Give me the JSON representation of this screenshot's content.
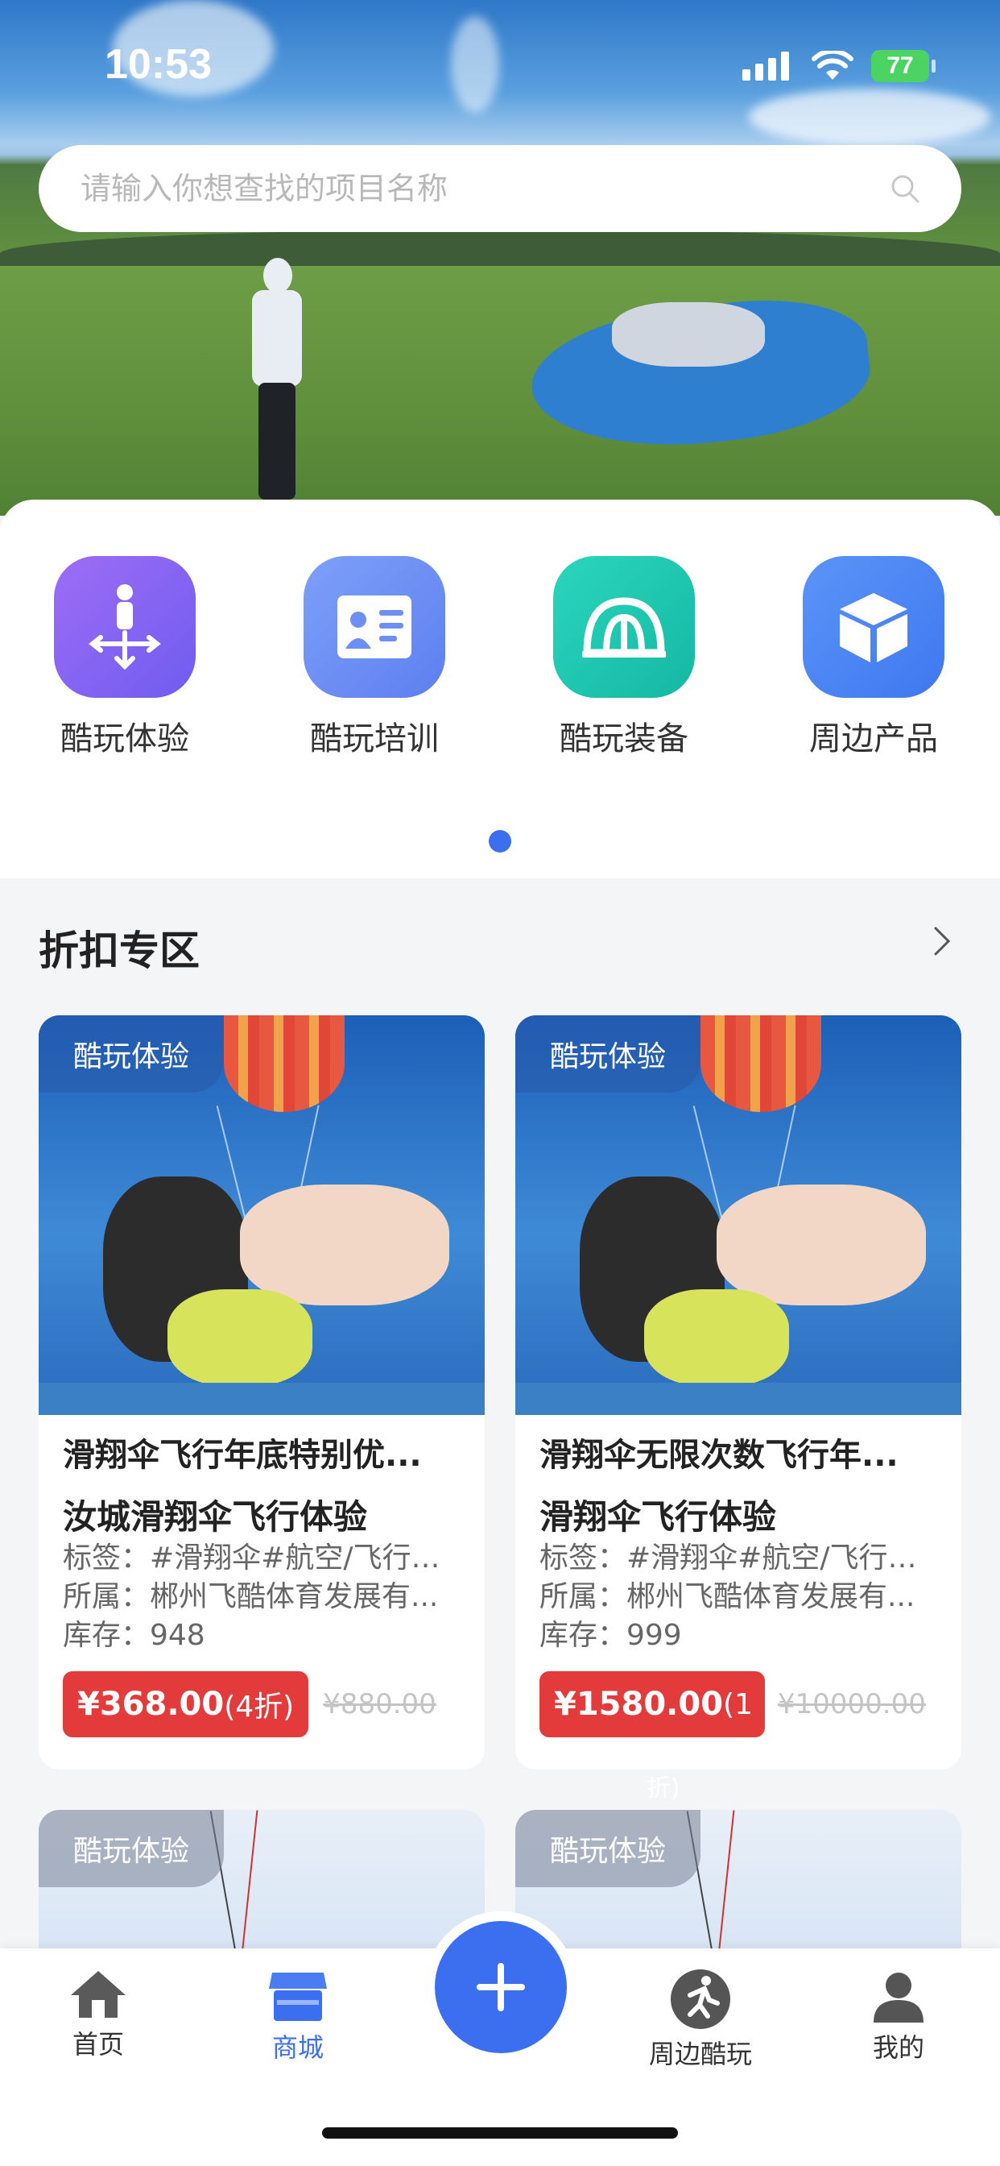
{
  "status_bar": {
    "time": "10:53",
    "battery": "77"
  },
  "search": {
    "placeholder": "请输入你想查找的项目名称"
  },
  "categories": [
    {
      "label": "酷玩体验",
      "icon": "person-arrows-icon",
      "color": "#8a63f2"
    },
    {
      "label": "酷玩培训",
      "icon": "training-board-icon",
      "color": "#6e8ff5"
    },
    {
      "label": "酷玩装备",
      "icon": "tent-icon",
      "color": "#22c9b0"
    },
    {
      "label": "周边产品",
      "icon": "box-icon",
      "color": "#4b86f4"
    }
  ],
  "section": {
    "title": "折扣专区"
  },
  "products": [
    {
      "tag": "酷玩体验",
      "title": "滑翔伞飞行年底特别优...",
      "subtitle": "汝城滑翔伞飞行体验",
      "tags": "标签：#滑翔伞#航空/飞行#...",
      "owner": "所属：郴州飞酷体育发展有...",
      "stock": "库存：948",
      "price": "¥368.00",
      "discount": "(4折)",
      "original": "¥880.00"
    },
    {
      "tag": "酷玩体验",
      "title": "滑翔伞无限次数飞行年...",
      "subtitle": "滑翔伞飞行体验",
      "tags": "标签：#滑翔伞#航空/飞行#...",
      "owner": "所属：郴州飞酷体育发展有...",
      "stock": "库存：999",
      "price": "¥1580.00",
      "discount": "(1",
      "original": "¥10000.00",
      "discount_overflow": "折)"
    },
    {
      "tag": "酷玩体验"
    },
    {
      "tag": "酷玩体验"
    }
  ],
  "nav": {
    "home": "首页",
    "mall": "商城",
    "nearby": "周边酷玩",
    "mine": "我的"
  },
  "colors": {
    "accent": "#3b6ff0",
    "price": "#e33b3b"
  }
}
